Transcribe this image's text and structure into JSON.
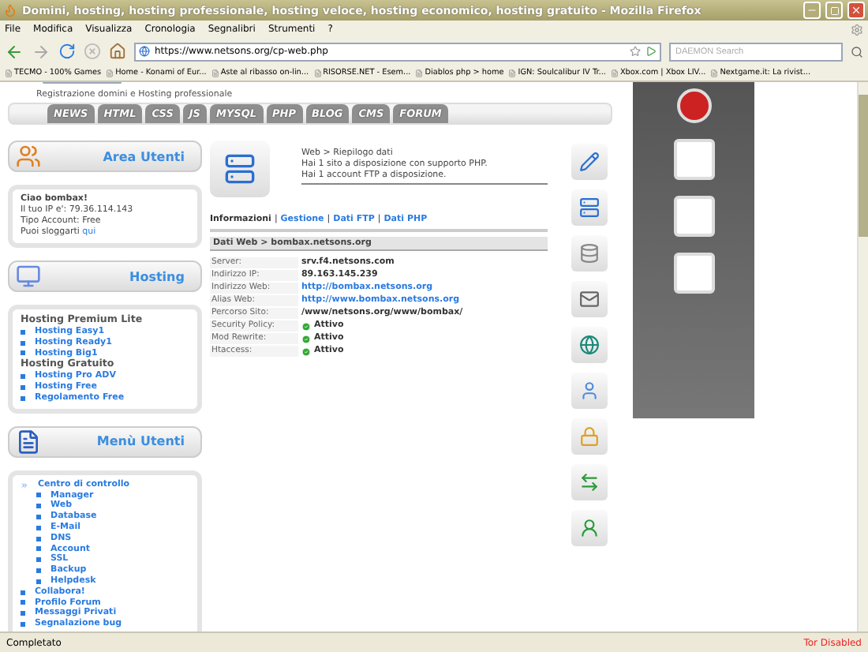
{
  "window": {
    "title": "Domini, hosting, hosting professionale, hosting veloce, hosting economico, hosting gratuito - Mozilla Firefox"
  },
  "menu": [
    "File",
    "Modifica",
    "Visualizza",
    "Cronologia",
    "Segnalibri",
    "Strumenti",
    "?"
  ],
  "address_bar": {
    "url": "https://www.netsons.org/cp-web.php"
  },
  "search": {
    "placeholder": "DAEMON Search"
  },
  "bookmarks": [
    "TECMO - 100% Games",
    "Home - Konami of Eur...",
    "Aste al ribasso on-lin...",
    "RISORSE.NET - Esem...",
    "Diablos php > home",
    "IGN: Soulcalibur IV Tr...",
    "Xbox.com | Xbox LIV...",
    "Nextgame.it: La rivist..."
  ],
  "site": {
    "tagline": "Registrazione domini e Hosting professionale",
    "nav_tabs": [
      "NEWS",
      "HTML",
      "CSS",
      "JS",
      "MYSQL",
      "PHP",
      "BLOG",
      "CMS",
      "FORUM"
    ]
  },
  "user_panel": {
    "title": "Area Utenti",
    "greeting": "Ciao bombax!",
    "lines": [
      "Il tuo IP e': 79.36.114.143",
      "Tipo Account: Free"
    ],
    "logout_text": "Puoi sloggarti",
    "logout_link": "qui"
  },
  "hosting_panel": {
    "title": "Hosting",
    "groups": [
      {
        "heading": "Hosting Premium Lite",
        "links": [
          "Hosting Easy1",
          "Hosting Ready1",
          "Hosting Big1"
        ]
      },
      {
        "heading": "Hosting Gratuito",
        "links": [
          "Hosting Pro ADV",
          "Hosting Free",
          "Regolamento Free"
        ]
      }
    ]
  },
  "menu_panel": {
    "title": "Menù Utenti",
    "items": [
      {
        "label": "Centro di controllo",
        "children": [
          {
            "label": "Manager"
          },
          {
            "label": "Web"
          },
          {
            "label": "Database"
          },
          {
            "label": "E-Mail"
          },
          {
            "label": "DNS"
          },
          {
            "label": "Account"
          },
          {
            "label": "SSL"
          },
          {
            "label": "Backup"
          },
          {
            "label": "Helpdesk"
          }
        ]
      },
      {
        "label": "Collabora!"
      },
      {
        "label": "Profilo Forum"
      },
      {
        "label": "Messaggi Privati"
      },
      {
        "label": "Segnalazione bug"
      }
    ]
  },
  "summary": {
    "lines": [
      "Web > Riepilogo dati",
      "Hai 1 sito a disposizione con supporto PHP.",
      "Hai 1 account FTP a disposizione."
    ]
  },
  "tabs": [
    {
      "label": "Informazioni",
      "selected": true
    },
    {
      "label": "Gestione",
      "selected": false
    },
    {
      "label": "Dati FTP",
      "selected": false
    },
    {
      "label": "Dati PHP",
      "selected": false
    }
  ],
  "tab_separator": "|",
  "section_title": "Dati Web > bombax.netsons.org",
  "fields": [
    {
      "label": "Server:",
      "value": "srv.f4.netsons.com",
      "kind": "text"
    },
    {
      "label": "Indirizzo IP:",
      "value": "89.163.145.239",
      "kind": "text"
    },
    {
      "label": "Indirizzo Web:",
      "value": "http://bombax.netsons.org",
      "kind": "link"
    },
    {
      "label": "Alias Web:",
      "value": "http://www.bombax.netsons.org",
      "kind": "link"
    },
    {
      "label": "Percorso Sito:",
      "value": "/www/netsons.org/www/bombax/",
      "kind": "text"
    },
    {
      "label": "Security Policy:",
      "value": "Attivo",
      "kind": "status"
    },
    {
      "label": "Mod Rewrite:",
      "value": "Attivo",
      "kind": "status"
    },
    {
      "label": "Htaccess:",
      "value": "Attivo",
      "kind": "status"
    }
  ],
  "status_bar": {
    "text": "Completato",
    "tor": "Tor Disabled"
  }
}
